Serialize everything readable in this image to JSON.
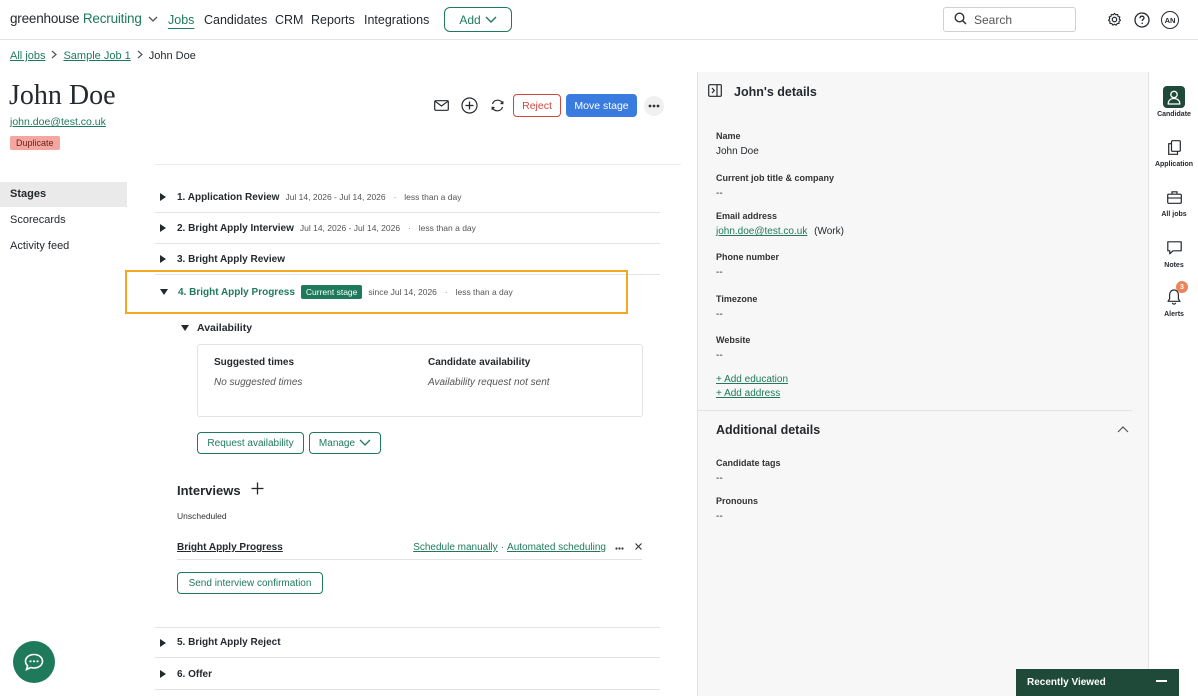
{
  "topnav": {
    "logo_main": "greenhouse",
    "logo_sub": "Recruiting",
    "links": [
      "Jobs",
      "Candidates",
      "CRM",
      "Reports",
      "Integrations"
    ],
    "add_label": "Add",
    "search_placeholder": "Search",
    "avatar_initials": "AN"
  },
  "breadcrumb": [
    "All jobs",
    "Sample Job 1",
    "John Doe"
  ],
  "candidate": {
    "name": "John Doe",
    "email": "john.doe@test.co.uk",
    "badge": "Duplicate",
    "reject_label": "Reject",
    "move_stage_label": "Move stage"
  },
  "sidebar": [
    "Stages",
    "Scorecards",
    "Activity feed"
  ],
  "stages": [
    {
      "name": "1. Application Review",
      "dates": "Jul 14, 2026 - Jul 14, 2026",
      "duration": "less than a day"
    },
    {
      "name": "2. Bright Apply Interview",
      "dates": "Jul 14, 2026 - Jul 14, 2026",
      "duration": "less than a day"
    },
    {
      "name": "3. Bright Apply Review",
      "dates": "",
      "duration": ""
    }
  ],
  "current_stage": {
    "name": "4. Bright Apply Progress",
    "badge": "Current stage",
    "since": "since Jul 14, 2026",
    "duration": "less than a day"
  },
  "availability": {
    "title": "Availability",
    "suggested_header": "Suggested times",
    "suggested_value": "No suggested times",
    "candidate_header": "Candidate availability",
    "candidate_value": "Availability request not sent",
    "request_label": "Request availability",
    "manage_label": "Manage"
  },
  "interviews": {
    "title": "Interviews",
    "status": "Unscheduled",
    "item_name": "Bright Apply Progress",
    "schedule_manually": "Schedule manually",
    "automated_scheduling": "Automated scheduling",
    "send_confirmation": "Send interview confirmation"
  },
  "later_stages": [
    "5. Bright Apply Reject",
    "6. Offer"
  ],
  "details": {
    "title": "John's details",
    "fields": [
      {
        "label": "Name",
        "value": "John Doe"
      },
      {
        "label": "Current job title & company",
        "value": "--"
      },
      {
        "label": "Email address",
        "value": "john.doe@test.co.uk",
        "suffix": "(Work)"
      },
      {
        "label": "Phone number",
        "value": "--"
      },
      {
        "label": "Timezone",
        "value": "--"
      },
      {
        "label": "Website",
        "value": "--"
      }
    ],
    "add_education": "+ Add education",
    "add_address": "+ Add address",
    "additional_title": "Additional details",
    "additional_fields": [
      {
        "label": "Candidate tags",
        "value": "--"
      },
      {
        "label": "Pronouns",
        "value": "--"
      }
    ]
  },
  "rail": {
    "items": [
      "Candidate",
      "Application",
      "All jobs",
      "Notes",
      "Alerts"
    ],
    "alerts_count": "3"
  },
  "recently_viewed": "Recently Viewed",
  "colors": {
    "brand_green": "#1f7a5c",
    "dark_green": "#1f4a3a",
    "primary_blue": "#3a7be0",
    "reject_red": "#d1453b",
    "highlight_orange": "#f5a623"
  }
}
